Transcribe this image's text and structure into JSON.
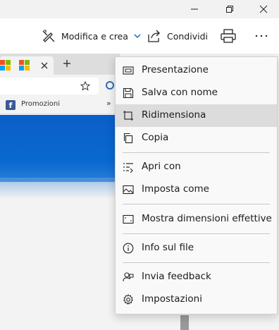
{
  "toolbar": {
    "edit_label": "Modifica e crea",
    "share_label": "Condividi"
  },
  "browser_bg": {
    "fav_label": "Promozioni"
  },
  "menu": {
    "items": [
      {
        "label": "Presentazione",
        "icon": "slideshow-icon"
      },
      {
        "label": "Salva con nome",
        "icon": "save-icon"
      },
      {
        "label": "Ridimensiona",
        "icon": "resize-icon",
        "active": true
      },
      {
        "label": "Copia",
        "icon": "copy-icon"
      },
      {
        "label": "Apri con",
        "icon": "open-with-icon"
      },
      {
        "label": "Imposta come",
        "icon": "set-as-icon"
      },
      {
        "label": "Mostra dimensioni effettive",
        "icon": "actual-size-icon"
      },
      {
        "label": "Info sul file",
        "icon": "info-icon"
      },
      {
        "label": "Invia feedback",
        "icon": "feedback-icon"
      },
      {
        "label": "Impostazioni",
        "icon": "settings-icon"
      }
    ]
  },
  "colors": {
    "accent": "#0f6cbd",
    "menu_highlight": "#dcdcdc"
  }
}
